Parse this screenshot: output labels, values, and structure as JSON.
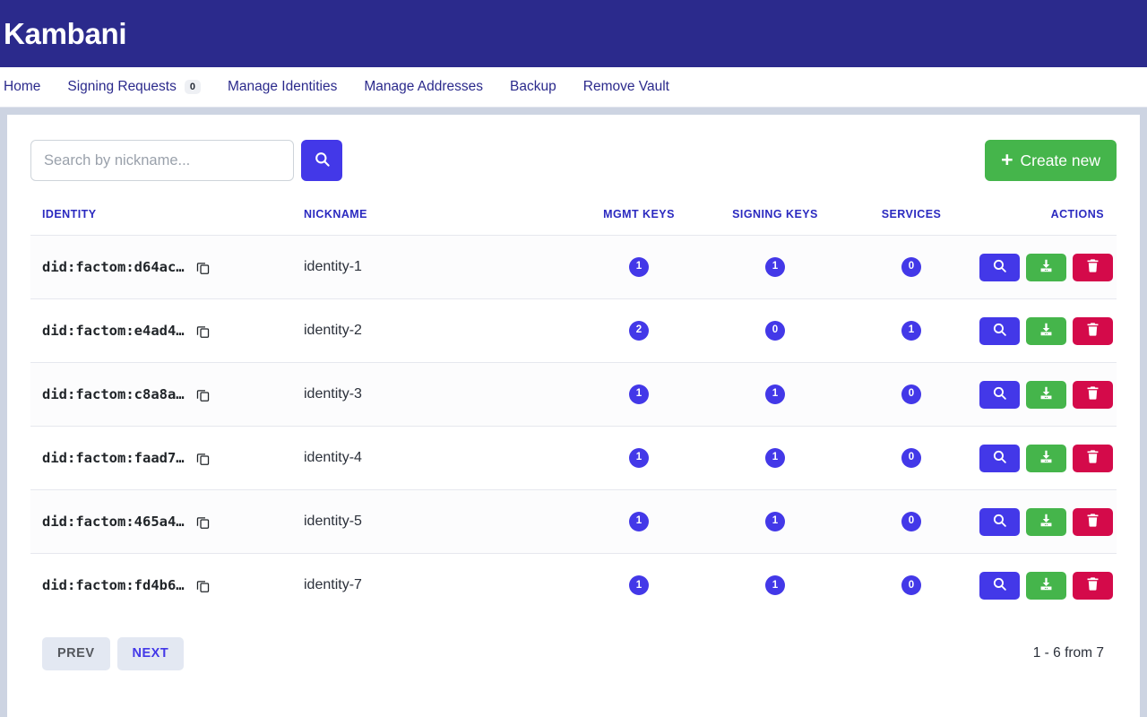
{
  "brand": {
    "title": "Kambani"
  },
  "nav": {
    "items": [
      {
        "label": "Home",
        "badge": null
      },
      {
        "label": "Signing Requests",
        "badge": "0"
      },
      {
        "label": "Manage Identities",
        "badge": null
      },
      {
        "label": "Manage Addresses",
        "badge": null
      },
      {
        "label": "Backup",
        "badge": null
      },
      {
        "label": "Remove Vault",
        "badge": null
      }
    ]
  },
  "toolbar": {
    "search_placeholder": "Search by nickname...",
    "search_value": "",
    "search_button_icon": "search-icon",
    "create_label": "Create new",
    "create_plus": "+"
  },
  "table": {
    "headers": {
      "identity": "IDENTITY",
      "nickname": "NICKNAME",
      "mgmt_keys": "MGMT KEYS",
      "signing_keys": "SIGNING KEYS",
      "services": "SERVICES",
      "actions": "ACTIONS"
    },
    "rows": [
      {
        "identity": "did:factom:d64ac…",
        "nickname": "identity-1",
        "mgmt_keys": "1",
        "signing_keys": "1",
        "services": "0"
      },
      {
        "identity": "did:factom:e4ad4…",
        "nickname": "identity-2",
        "mgmt_keys": "2",
        "signing_keys": "0",
        "services": "1"
      },
      {
        "identity": "did:factom:c8a8a…",
        "nickname": "identity-3",
        "mgmt_keys": "1",
        "signing_keys": "1",
        "services": "0"
      },
      {
        "identity": "did:factom:faad7…",
        "nickname": "identity-4",
        "mgmt_keys": "1",
        "signing_keys": "1",
        "services": "0"
      },
      {
        "identity": "did:factom:465a4…",
        "nickname": "identity-5",
        "mgmt_keys": "1",
        "signing_keys": "1",
        "services": "0"
      },
      {
        "identity": "did:factom:fd4b6…",
        "nickname": "identity-7",
        "mgmt_keys": "1",
        "signing_keys": "1",
        "services": "0"
      }
    ],
    "row_actions": {
      "view_icon": "search-icon",
      "download_icon": "download-icon",
      "delete_icon": "trash-icon",
      "copy_icon": "copy-icon"
    }
  },
  "footer": {
    "prev_label": "PREV",
    "next_label": "NEXT",
    "range_label": "1 - 6 from 7"
  },
  "colors": {
    "brand_bg": "#2b2a8c",
    "accent_blue": "#4338e8",
    "green": "#45b54b",
    "crimson": "#d40a4a",
    "page_bg": "#cdd4e2"
  }
}
